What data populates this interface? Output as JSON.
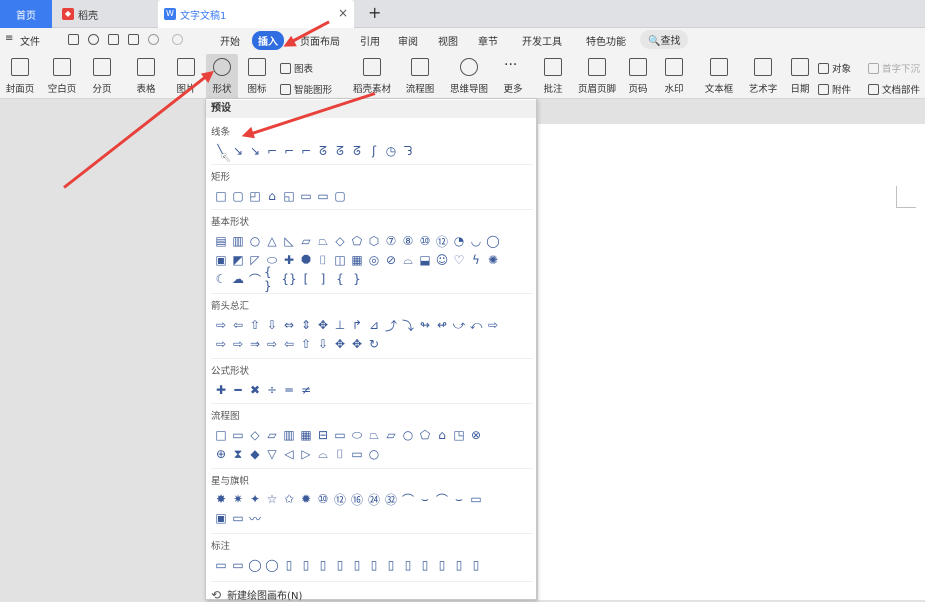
{
  "tabs": {
    "home": "首页",
    "dk": "稻壳",
    "doc": "文字文稿1",
    "close": "×",
    "add": "+"
  },
  "menubar": {
    "hamburger": "≡",
    "file": "文件",
    "start": "开始",
    "insert": "插入",
    "layout": "页面布局",
    "ref": "引用",
    "review": "审阅",
    "view": "视图",
    "chapter": "章节",
    "dev": "开发工具",
    "special": "特色功能",
    "search": "查找"
  },
  "ribbon": {
    "cover": "封面页",
    "blank": "空白页",
    "pagebreak": "分页",
    "table": "表格",
    "image": "图片",
    "shape": "形状",
    "icon": "图标",
    "chart": "图表",
    "smartart": "智能图形",
    "dk_material": "稻壳素材",
    "flow": "流程图",
    "mindmap": "思维导图",
    "more": "更多",
    "comment": "批注",
    "header_footer": "页眉页脚",
    "page_no": "页码",
    "watermark": "水印",
    "textbox": "文本框",
    "wordart": "艺术字",
    "date": "日期",
    "object": "对象",
    "attach": "附件",
    "dropcap": "首字下沉",
    "docpart": "文档部件"
  },
  "panel": {
    "preset": "预设",
    "cats": [
      "线条",
      "矩形",
      "基本形状",
      "箭头总汇",
      "公式形状",
      "流程图",
      "星与旗帜",
      "标注"
    ],
    "new_canvas": "新建绘图画布(N)"
  },
  "glyphs": {
    "lines": [
      "╲",
      "↘",
      "↘",
      "⌐",
      "⌐",
      "⌐",
      "ᘔ",
      "ᘔ",
      "ᘔ",
      "ʃ",
      "◷",
      "ᘊ"
    ],
    "rects": [
      "□",
      "▢",
      "◰",
      "⌂",
      "◱",
      "▭",
      "▭",
      "▢"
    ],
    "basic1": [
      "▤",
      "▥",
      "○",
      "△",
      "◺",
      "▱",
      "⏢",
      "◇",
      "⬠",
      "⬡",
      "⑦",
      "⑧",
      "⑩",
      "⑫",
      "◔",
      "◡",
      "◯"
    ],
    "basic2": [
      "▣",
      "◩",
      "◸",
      "⬭",
      "✚",
      "⯃",
      "⌷",
      "◫",
      "▦",
      "◎",
      "⊘",
      "⌓",
      "⬓",
      "☺",
      "♡",
      "ϟ",
      "✺"
    ],
    "basic3": [
      "☾",
      "☁",
      "⌒",
      "{ }",
      "{}",
      "[",
      "]",
      "{",
      "}"
    ],
    "arrows1": [
      "⇨",
      "⇦",
      "⇧",
      "⇩",
      "⇔",
      "⇕",
      "✥",
      "⊥",
      "↱",
      "⊿",
      "⤴",
      "⤵",
      "↬",
      "↫",
      "⤻",
      "⤺",
      "⇨"
    ],
    "arrows2": [
      "⇨",
      "⇨",
      "⇒",
      "⇨",
      "⇦",
      "⇧",
      "⇩",
      "✥",
      "✥",
      "↻"
    ],
    "formula": [
      "✚",
      "━",
      "✖",
      "÷",
      "═",
      "≠"
    ],
    "flow1": [
      "□",
      "▭",
      "◇",
      "▱",
      "▥",
      "▦",
      "⊟",
      "▭",
      "⬭",
      "⏢",
      "⏥",
      "○",
      "⬠",
      "⌂",
      "◳",
      "⊗"
    ],
    "flow2": [
      "⊕",
      "⧗",
      "◆",
      "▽",
      "◁",
      "▷",
      "⌓",
      "⌷",
      "▭",
      "○"
    ],
    "stars1": [
      "✸",
      "✷",
      "✦",
      "☆",
      "✩",
      "✹",
      "⑩",
      "⑫",
      "⑯",
      "㉔",
      "㉜",
      "⌒",
      "⌣",
      "⌒",
      "⌣",
      "▭"
    ],
    "stars2": [
      "▣",
      "▭",
      "〰"
    ],
    "callouts": [
      "▭",
      "▭",
      "◯",
      "◯",
      "▯",
      "▯",
      "▯",
      "▯",
      "▯",
      "▯",
      "▯",
      "▯",
      "▯",
      "▯",
      "▯",
      "▯"
    ]
  }
}
